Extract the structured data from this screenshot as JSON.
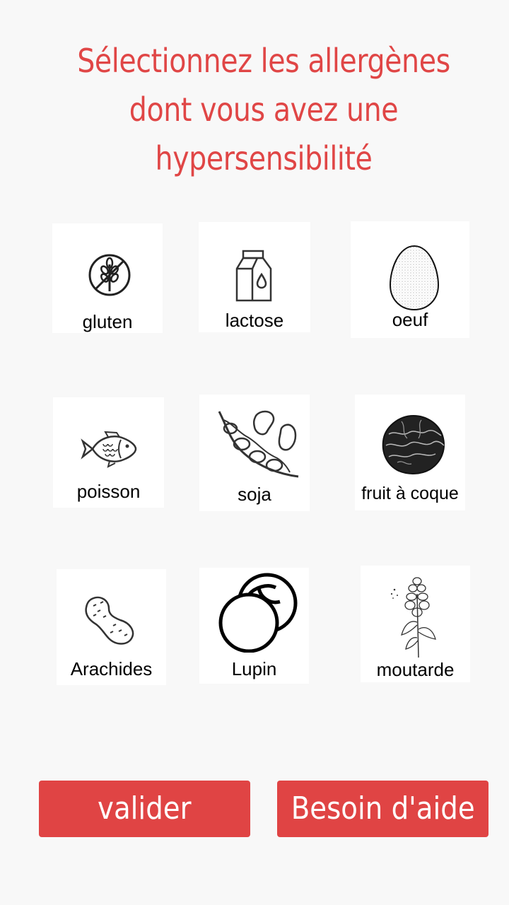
{
  "title": {
    "line1": "Sélectionnez les allergènes",
    "line2": "dont vous avez une",
    "line3": "hypersensibilité"
  },
  "allergens": [
    {
      "label": "gluten",
      "icon": "wheat-crossed-icon"
    },
    {
      "label": "lactose",
      "icon": "milk-carton-icon"
    },
    {
      "label": "oeuf",
      "icon": "egg-icon"
    },
    {
      "label": "poisson",
      "icon": "fish-icon"
    },
    {
      "label": "soja",
      "icon": "soybean-icon"
    },
    {
      "label": "fruit à coque",
      "icon": "walnut-icon"
    },
    {
      "label": "Arachides",
      "icon": "peanut-icon"
    },
    {
      "label": "Lupin",
      "icon": "lupin-icon"
    },
    {
      "label": "moutarde",
      "icon": "mustard-plant-icon"
    }
  ],
  "buttons": {
    "validate": "valider",
    "help": "Besoin d'aide"
  },
  "colors": {
    "accent": "#e04444",
    "background": "#f8f8f8",
    "tile": "#ffffff"
  }
}
